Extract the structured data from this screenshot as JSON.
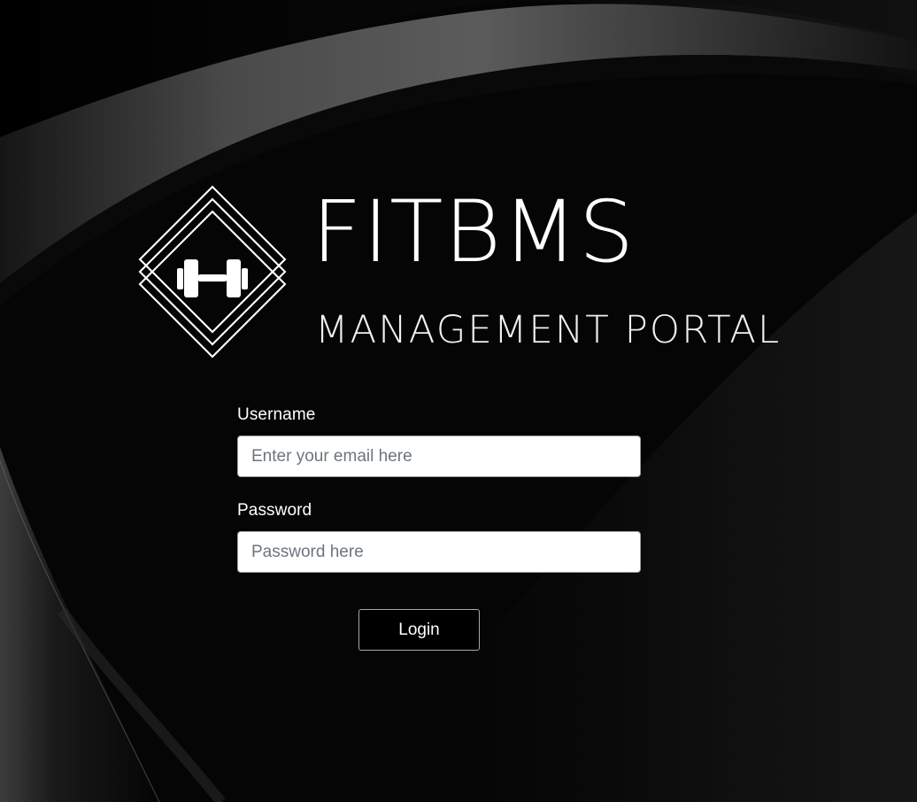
{
  "brand": {
    "name": "FITBMS",
    "subtitle": "MANAGEMENT PORTAL",
    "logo_icon": "dumbbell-icon"
  },
  "login_form": {
    "username_label": "Username",
    "username_placeholder": "Enter your email here",
    "username_value": "",
    "password_label": "Password",
    "password_placeholder": "Password here",
    "password_value": "",
    "login_button_label": "Login"
  },
  "colors": {
    "background": "#050505",
    "text": "#ffffff",
    "input_background": "#ffffff",
    "placeholder": "#6c757d",
    "button_background": "#000000"
  }
}
